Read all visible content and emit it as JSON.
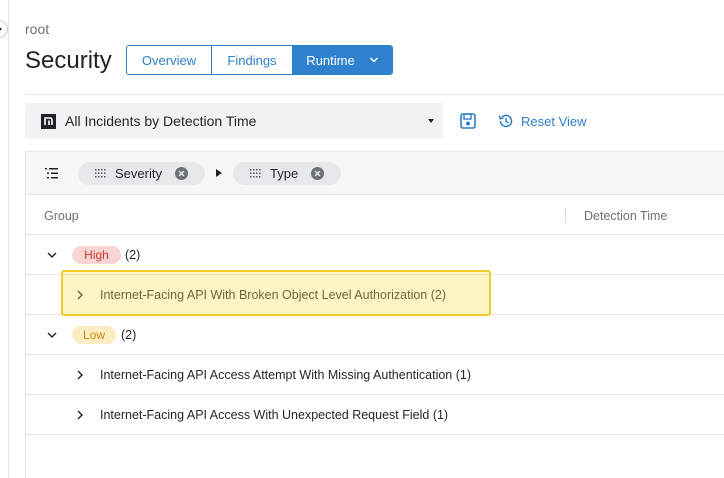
{
  "breadcrumb": "root",
  "page_title": "Security",
  "tabs": [
    {
      "label": "Overview",
      "active": false
    },
    {
      "label": "Findings",
      "active": false
    },
    {
      "label": "Runtime",
      "active": true
    }
  ],
  "view_selector": {
    "label": "All Incidents by Detection Time"
  },
  "actions": {
    "reset_label": "Reset View"
  },
  "grouping": {
    "chips": [
      "Severity",
      "Type"
    ]
  },
  "columns": {
    "group": "Group",
    "detection_time": "Detection Time"
  },
  "groups": [
    {
      "severity": "High",
      "count": "(2)",
      "children": [
        {
          "label": "Internet-Facing API With Broken Object Level Authorization",
          "count": "(2)"
        }
      ]
    },
    {
      "severity": "Low",
      "count": "(2)",
      "children": [
        {
          "label": "Internet-Facing API Access Attempt With Missing Authentication",
          "count": "(1)"
        },
        {
          "label": "Internet-Facing API Access With Unexpected Request Field",
          "count": "(1)"
        }
      ]
    }
  ],
  "colors": {
    "accent": "#2f80cd",
    "high_badge_bg": "#f8d4d4",
    "high_badge_text": "#c8392e",
    "low_badge_bg": "#fbedc2",
    "low_badge_text": "#c98a10",
    "highlight": "#f0cc2e"
  }
}
